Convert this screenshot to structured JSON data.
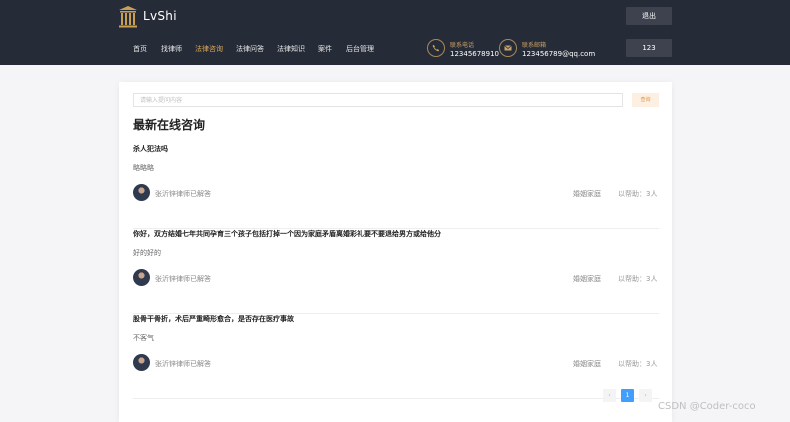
{
  "header": {
    "brand": "LvShi",
    "logout_label": "退出",
    "user_label": "123",
    "nav": [
      {
        "label": "首页",
        "active": false
      },
      {
        "label": "找律师",
        "active": false
      },
      {
        "label": "法律咨询",
        "active": true
      },
      {
        "label": "法律问答",
        "active": false
      },
      {
        "label": "法律知识",
        "active": false
      },
      {
        "label": "案件",
        "active": false
      },
      {
        "label": "后台管理",
        "active": false
      }
    ],
    "phone": {
      "label": "联系电话",
      "value": "12345678910",
      "icon": "phone-icon"
    },
    "email": {
      "label": "联系邮箱",
      "value": "123456789@qq.com",
      "icon": "mail-icon"
    }
  },
  "search": {
    "placeholder": "请输入提问内容",
    "button_label": "查询"
  },
  "heading": "最新在线咨询",
  "consultations": [
    {
      "title": "杀人犯法吗",
      "answer": "略略略",
      "lawyer": "张沂锌律师已解答",
      "category": "婚姻家庭",
      "helped": "以帮助：3人"
    },
    {
      "title": "你好，双方结婚七年共同孕育三个孩子包括打掉一个因为家庭矛盾离婚彩礼要不要退给男方或给他分",
      "answer": "好的好的",
      "lawyer": "张沂锌律师已解答",
      "category": "婚姻家庭",
      "helped": "以帮助：3人"
    },
    {
      "title": "股骨干骨折，术后严重畸形愈合，是否存在医疗事故",
      "answer": "不客气",
      "lawyer": "张沂锌律师已解答",
      "category": "婚姻家庭",
      "helped": "以帮助：3人"
    }
  ],
  "pagination": {
    "prev": "‹",
    "current": "1",
    "next": "›"
  },
  "watermark": "CSDN @Coder-coco",
  "colors": {
    "header_bg": "#262b38",
    "accent": "#d9a85b",
    "pager_active": "#409eff"
  }
}
